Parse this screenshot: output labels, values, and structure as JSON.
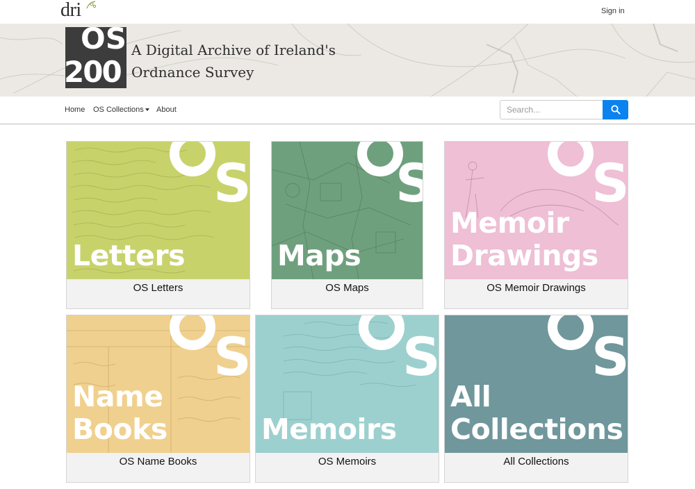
{
  "header": {
    "logo_text": "dri",
    "signin_label": "Sign in"
  },
  "banner": {
    "logo_lines": [
      "OS",
      "200"
    ],
    "title_line1": "A Digital Archive of Ireland's",
    "title_line2": "Ordnance Survey"
  },
  "nav": {
    "home": "Home",
    "collections": "OS Collections",
    "about": "About",
    "search_placeholder": "Search..."
  },
  "cards": [
    {
      "big_line1": "Letters",
      "big_line2": "",
      "caption": "OS Letters",
      "color": "#c8d26b"
    },
    {
      "big_line1": "Maps",
      "big_line2": "",
      "caption": "OS Maps",
      "color": "#6fa07e"
    },
    {
      "big_line1": "Memoir",
      "big_line2": "Drawings",
      "caption": "OS Memoir Drawings",
      "color": "#eebfd5"
    },
    {
      "big_line1": "Name",
      "big_line2": "Books",
      "caption": "OS Name Books",
      "color": "#f0d08e"
    },
    {
      "big_line1": "Memoirs",
      "big_line2": "",
      "caption": "OS Memoirs",
      "color": "#9cd0ce"
    },
    {
      "big_line1": "All",
      "big_line2": "Collections",
      "caption": "All Collections",
      "color": "#6f979c"
    }
  ],
  "icons": {
    "search": "search-icon",
    "leaf": "leaf-icon",
    "caret": "caret-down-icon"
  }
}
